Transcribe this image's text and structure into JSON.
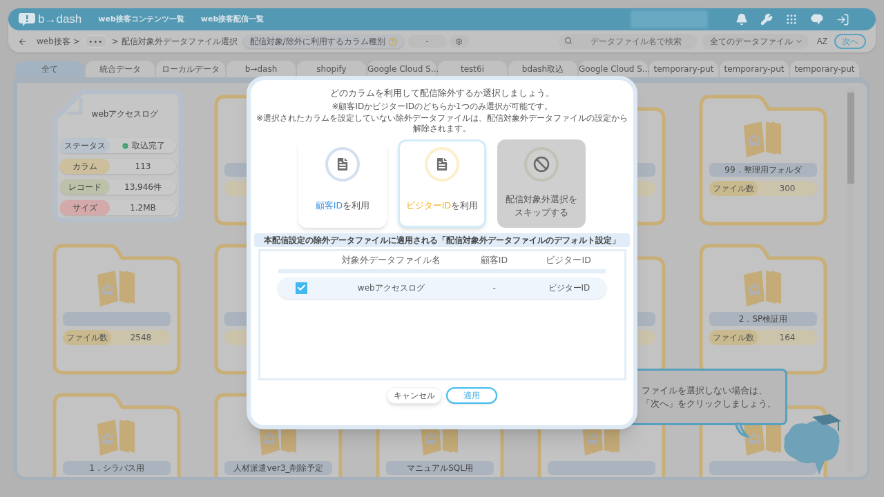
{
  "header": {
    "logo": "b→dash",
    "nav": [
      "web接客コンテンツ一覧",
      "web接客配信一覧"
    ]
  },
  "toolbar": {
    "breadcrumb": "web接客 >",
    "more": "•••",
    "current": "> 配信対象外データファイル選択",
    "column_type": {
      "label": "配信対象/除外に利用するカラム種別",
      "value": "-"
    },
    "search": {
      "placeholder": "データファイル名で検索"
    },
    "filter": "全てのデータファイル",
    "sort": "AZ",
    "next": "次へ"
  },
  "tabs": [
    {
      "label": "全て",
      "selected": true
    },
    {
      "label": "統合データ",
      "selected": false
    },
    {
      "label": "ローカルデータ",
      "selected": false
    },
    {
      "label": "b→dash",
      "selected": false
    },
    {
      "label": "shopify",
      "selected": false
    },
    {
      "label": "Google Cloud S…",
      "selected": false
    },
    {
      "label": "test6i",
      "selected": false
    },
    {
      "label": "bdash取込",
      "selected": false
    },
    {
      "label": "Google Cloud S…",
      "selected": false
    },
    {
      "label": "temporary-put",
      "selected": false
    },
    {
      "label": "temporary-put",
      "selected": false
    },
    {
      "label": "temporary-put",
      "selected": false
    }
  ],
  "cards": [
    {
      "kind": "file",
      "name": "webアクセスログ",
      "stats": [
        {
          "kind": "status",
          "label": "ステータス",
          "value": "取込完了",
          "color": "#b9c3cd"
        },
        {
          "kind": "plain",
          "label": "カラム",
          "value": "113",
          "color": "#cdbf9b"
        },
        {
          "kind": "plain",
          "label": "レコード",
          "value": "13,946件",
          "color": "#bcc1aa"
        },
        {
          "kind": "plain",
          "label": "サイズ",
          "value": "1.2MB",
          "color": "#d3a9a9"
        }
      ]
    },
    {
      "kind": "folder_edge"
    },
    {
      "kind": "covered"
    },
    {
      "kind": "folder_edge"
    },
    {
      "kind": "folder",
      "name": "99．整理用フォルダ",
      "count_label": "ファイル数",
      "count": "300"
    },
    {
      "kind": "folder",
      "count_label": "ファイル数",
      "count": "2548"
    },
    {
      "kind": "folder_edge"
    },
    {
      "kind": "covered"
    },
    {
      "kind": "folder_edge"
    },
    {
      "kind": "folder",
      "name": "2．SP検証用",
      "count_label": "ファイル数",
      "count": "164"
    },
    {
      "kind": "folder",
      "name": "1．シラバス用"
    },
    {
      "kind": "folder",
      "name": "人材派遣ver3_削除予定"
    },
    {
      "kind": "folder",
      "name": "マニュアルSQL用"
    },
    {
      "kind": "folder"
    },
    {
      "kind": "folder"
    }
  ],
  "hint": {
    "lines": [
      "ファイルを選択しない場合は、",
      "「次へ」をクリックしましょう。"
    ]
  },
  "modal": {
    "title": "どのカラムを利用して配信除外するか選択しましょう。",
    "notes": [
      "※顧客IDかビジターIDのどちらか1つのみ選択が可能です。",
      "※選択されたカラムを設定していない除外データファイルは、配信対象外データファイルの設定から解除されます。"
    ],
    "options": [
      {
        "kind": "id",
        "highlight": "顧客ID",
        "rest": "を利用",
        "color": "#3d8fe0",
        "selected": false
      },
      {
        "kind": "id",
        "highlight": "ビジターID",
        "rest": "を利用",
        "color": "#f2b01e",
        "selected": true
      },
      {
        "kind": "skip",
        "lines": [
          "配信対象外選択を",
          "スキップする"
        ],
        "selected": false
      }
    ],
    "section": "本配信設定の除外データファイルに適用される「配信対象外データファイルのデフォルト設定」",
    "table": {
      "columns": [
        "対象外データファイル名",
        "顧客ID",
        "ビジターID"
      ],
      "rows": [
        {
          "checked": true,
          "cells": [
            "webアクセスログ",
            "-",
            "ビジターID"
          ]
        }
      ]
    },
    "cancel": "キャンセル",
    "apply": "適用"
  }
}
